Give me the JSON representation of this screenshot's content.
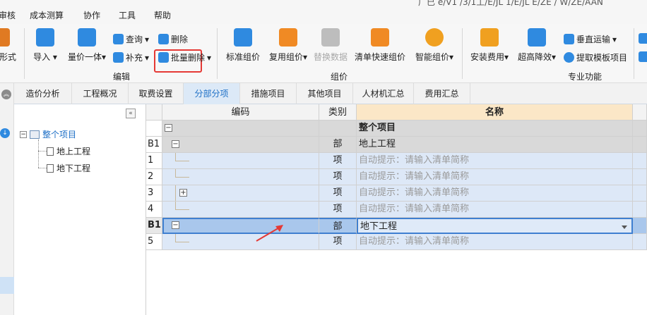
{
  "menubar": {
    "items": [
      "审核",
      "成本测算",
      "协作",
      "工具",
      "帮助"
    ],
    "title_fragment": "广已 e/V1 /3/1工/E/JL   1/E/JL E/ZE   / W/ZE/AAN"
  },
  "ribbon": {
    "left_partial_label": "形式",
    "groups": {
      "edit": "编辑",
      "pricing": "组价",
      "professional": "专业功能"
    },
    "buttons": {
      "import": "导入",
      "quantity_price": "量价一体",
      "query": "查询",
      "delete": "删除",
      "supplement": "补充",
      "batch_delete": "批量删除",
      "standard_group": "标准组价",
      "reuse_group": "复用组价",
      "replace_data": "替换数据",
      "quick_group": "清单快速组价",
      "smart_group": "智能组价",
      "install_fee": "安装费用",
      "height_reduce": "超高降效",
      "vertical_transport": "垂直运输",
      "extract_template": "提取模板项目"
    }
  },
  "tabs": [
    "造价分析",
    "工程概况",
    "取费设置",
    "分部分项",
    "措施项目",
    "其他项目",
    "人材机汇总",
    "费用汇总"
  ],
  "active_tab": "分部分项",
  "tree": {
    "collapse_glyph": "«",
    "root": "整个项目",
    "children": [
      "地上工程",
      "地下工程"
    ]
  },
  "grid": {
    "headers": {
      "code": "编码",
      "type": "类别",
      "name": "名称"
    },
    "rows": [
      {
        "no": "",
        "type": "",
        "name": "整个项目",
        "toggle": "−"
      },
      {
        "no": "B1",
        "type": "部",
        "name": "地上工程",
        "toggle": "−"
      },
      {
        "no": "1",
        "type": "项",
        "name": "自动提示：请输入清单简称"
      },
      {
        "no": "2",
        "type": "项",
        "name": "自动提示：请输入清单简称"
      },
      {
        "no": "3",
        "type": "项",
        "name": "自动提示：请输入清单简称",
        "toggle": "+"
      },
      {
        "no": "4",
        "type": "项",
        "name": "自动提示：请输入清单简称"
      },
      {
        "no": "B1",
        "type": "部",
        "name": "地下工程",
        "toggle": "−"
      },
      {
        "no": "5",
        "type": "项",
        "name": "自动提示：请输入清单简称"
      }
    ]
  },
  "colors": {
    "accent_blue": "#1d6fc6",
    "highlight_red": "#e53935",
    "arrow_red": "#e53935"
  }
}
